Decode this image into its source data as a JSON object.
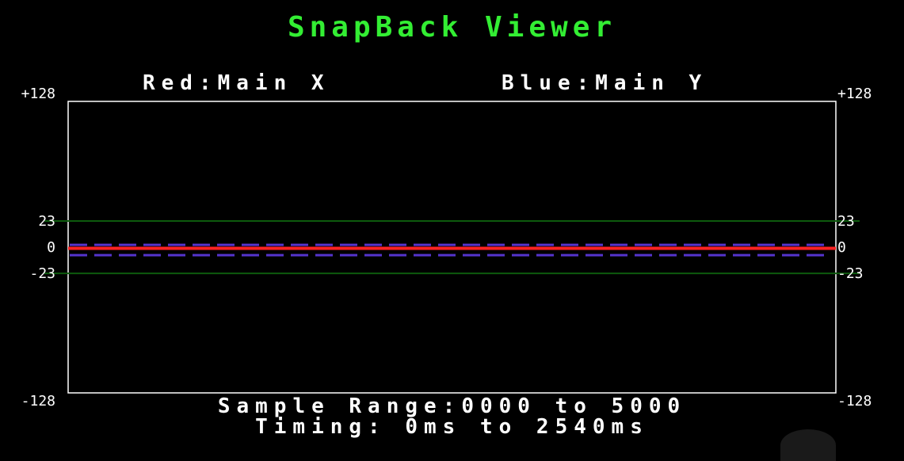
{
  "app": {
    "title": "SnapBack Viewer"
  },
  "legend": {
    "red": "Red:Main X",
    "blue": "Blue:Main Y"
  },
  "footer": {
    "range": "Sample Range:0000 to 5000",
    "timing": "Timing: 0ms to 2540ms"
  },
  "colors": {
    "title": "#33ee33",
    "frame": "#ffffff",
    "threshold": "#0d5a0d",
    "series_x": "#ff2222",
    "series_y": "#5533cc"
  },
  "chart_data": {
    "type": "line",
    "title": "SnapBack Viewer",
    "ylim": [
      -128,
      128
    ],
    "xlim": [
      0,
      5000
    ],
    "y_ticks": [
      "+128",
      "23",
      "0",
      "-23",
      "-128"
    ],
    "y_tick_values": [
      128,
      23,
      0,
      -23,
      -128
    ],
    "threshold_lines": [
      23,
      -23
    ],
    "series": [
      {
        "name": "Red:Main X",
        "color": "#ff2222",
        "style": "solid",
        "values_constant": -1
      },
      {
        "name": "Blue:Main Y",
        "color": "#5533cc",
        "style": "dashed",
        "values_band": [
          2,
          -7
        ]
      }
    ],
    "grid": false,
    "legend_placement": "top"
  }
}
